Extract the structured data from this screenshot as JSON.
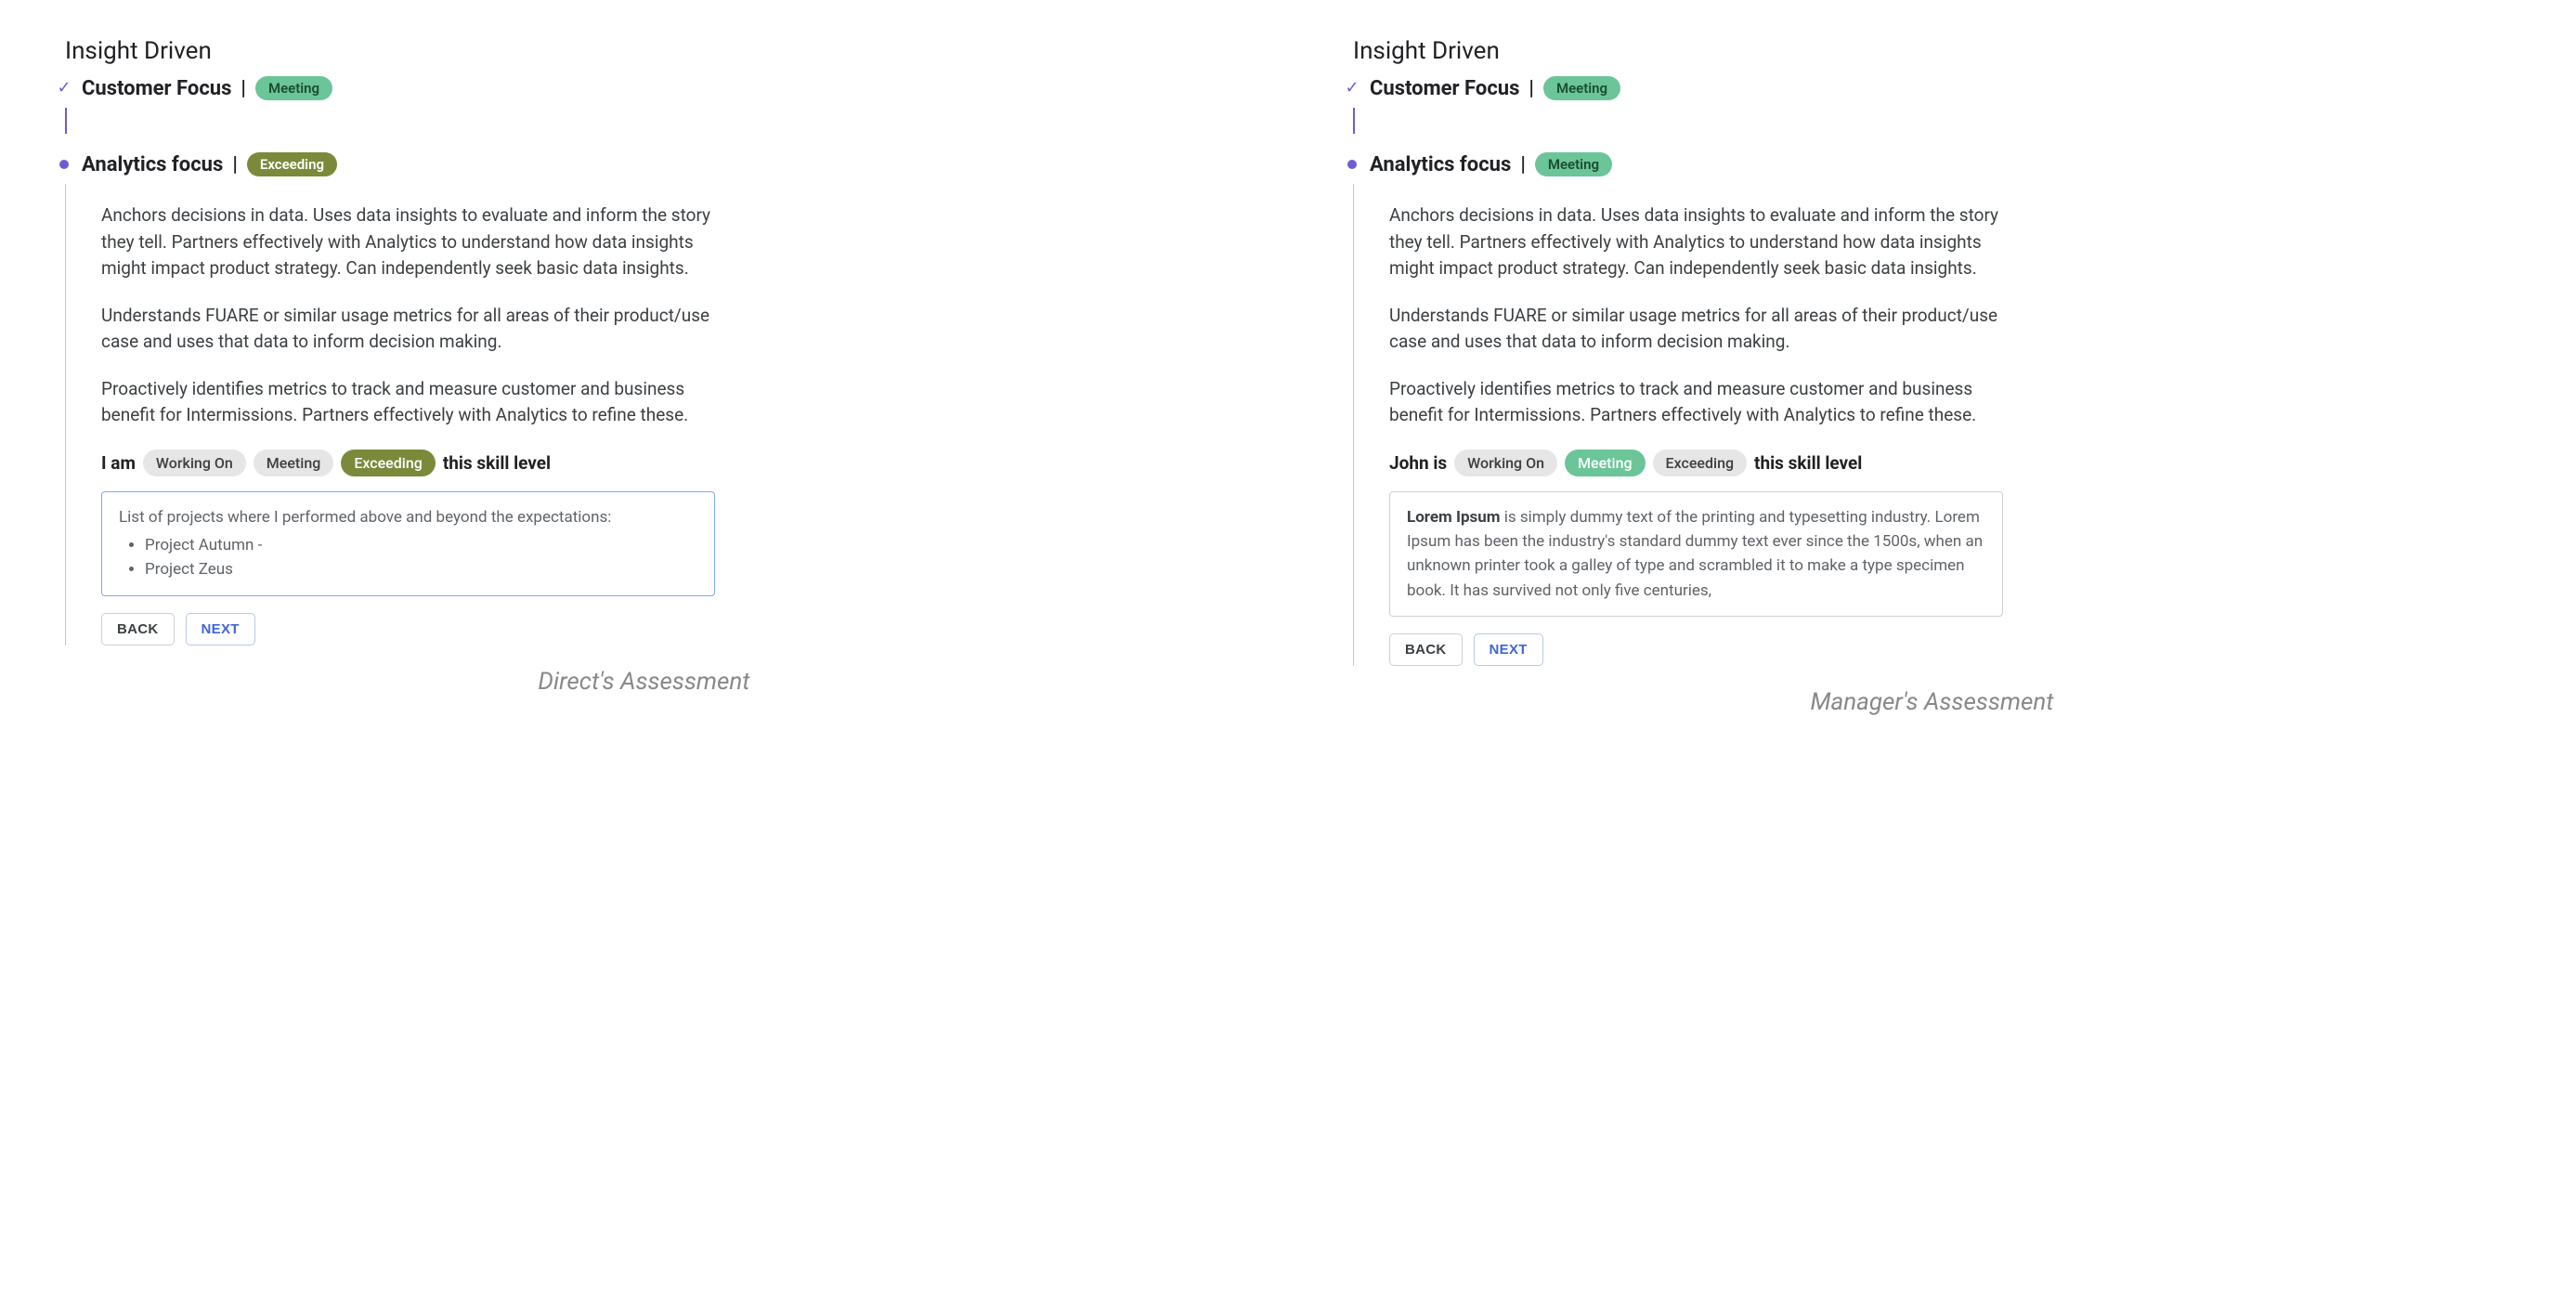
{
  "left": {
    "section_header": "Insight Driven",
    "item1": {
      "title": "Customer Focus",
      "badge": "Meeting"
    },
    "item2": {
      "title": "Analytics focus",
      "badge": "Exceeding"
    },
    "description": {
      "p1": "Anchors decisions in data. Uses data insights to evaluate and inform the story they tell. Partners effectively with Analytics to understand how data insights might impact product strategy. Can independently seek basic data insights.",
      "p2": "Understands FUARE or similar usage metrics for all areas of their product/use case and uses that data to inform decision making.",
      "p3": "Proactively identifies metrics to track and measure customer and business benefit for Intermissions. Partners effectively with Analytics to refine these."
    },
    "skill": {
      "prefix": "I am",
      "chips": {
        "working_on": "Working On",
        "meeting": "Meeting",
        "exceeding": "Exceeding"
      },
      "suffix": "this skill level",
      "selected": "exceeding"
    },
    "notes": {
      "intro": "List of projects where I performed above and beyond the expectations:",
      "items": [
        "Project Autumn -",
        "Project Zeus"
      ]
    },
    "buttons": {
      "back": "BACK",
      "next": "NEXT"
    },
    "caption": "Direct's Assessment"
  },
  "right": {
    "section_header": "Insight Driven",
    "item1": {
      "title": "Customer Focus",
      "badge": "Meeting"
    },
    "item2": {
      "title": "Analytics focus",
      "badge": "Meeting"
    },
    "description": {
      "p1": "Anchors decisions in data. Uses data insights to evaluate and inform the story they tell. Partners effectively with Analytics to understand how data insights might impact product strategy. Can independently seek basic data insights.",
      "p2": "Understands FUARE or similar usage metrics for all areas of their product/use case and uses that data to inform decision making.",
      "p3": "Proactively identifies metrics to track and measure customer and business benefit for Intermissions. Partners effectively with Analytics to refine these."
    },
    "skill": {
      "prefix": "John is",
      "chips": {
        "working_on": "Working On",
        "meeting": "Meeting",
        "exceeding": "Exceeding"
      },
      "suffix": "this skill level",
      "selected": "meeting"
    },
    "notes": {
      "bold": "Lorem Ipsum",
      "rest": " is simply dummy text of the printing and typesetting industry. Lorem Ipsum has been the industry's standard dummy text ever since the 1500s, when an unknown printer took a galley of type and scrambled it to make a type specimen book. It has survived not only five centuries,"
    },
    "buttons": {
      "back": "BACK",
      "next": "NEXT"
    },
    "caption": "Manager's Assessment"
  }
}
